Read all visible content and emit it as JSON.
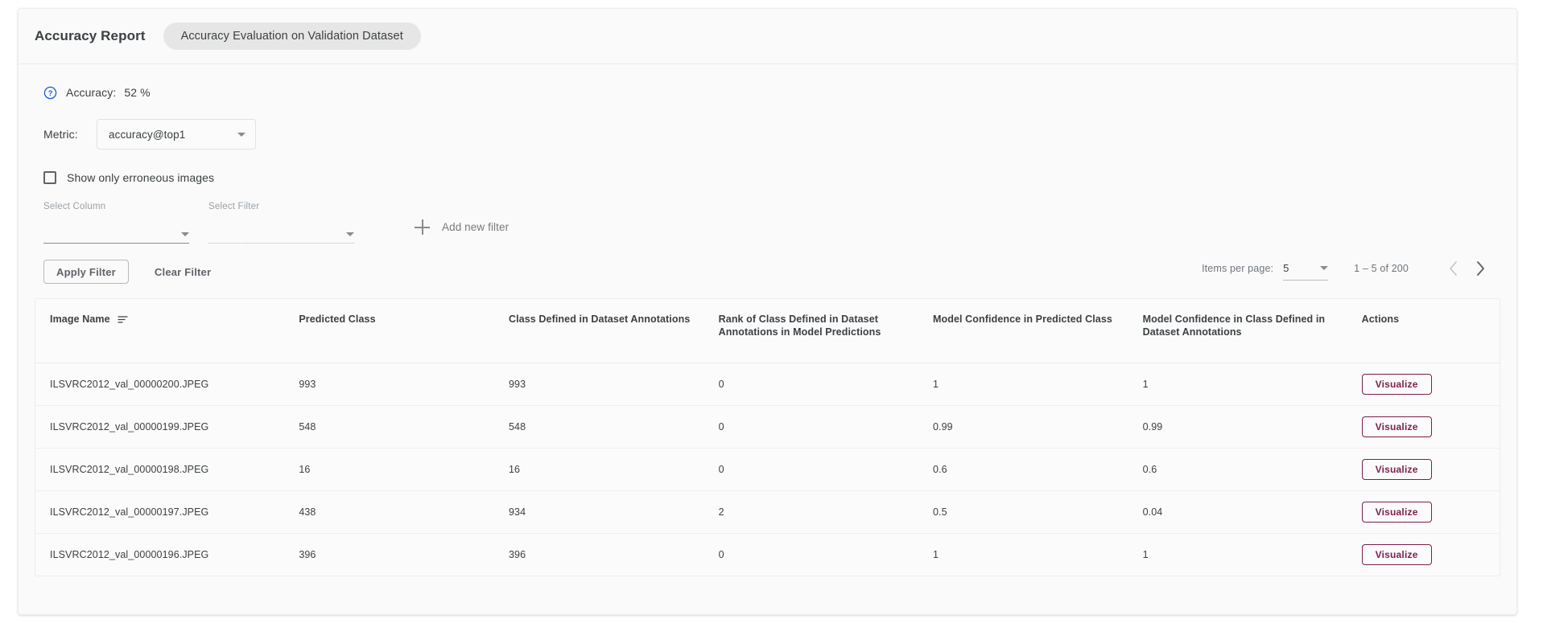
{
  "header": {
    "title": "Accuracy Report",
    "chip": "Accuracy Evaluation on Validation Dataset"
  },
  "summary": {
    "help_icon": "help-circle-icon",
    "accuracy_label": "Accuracy:",
    "accuracy_value": "52 %"
  },
  "metric": {
    "label": "Metric:",
    "selected": "accuracy@top1"
  },
  "erroneous": {
    "label": "Show only erroneous images",
    "checked": false
  },
  "filters": {
    "select_column_label": "Select Column",
    "select_column_value": "",
    "select_filter_label": "Select Filter",
    "select_filter_value": "",
    "add_new_filter": "Add new filter",
    "apply_label": "Apply Filter",
    "clear_label": "Clear Filter"
  },
  "paginator": {
    "items_per_page_label": "Items per page:",
    "items_per_page_value": "5",
    "range_label": "1 – 5 of 200",
    "prev_icon": "chevron-left-icon",
    "next_icon": "chevron-right-icon"
  },
  "table": {
    "columns": [
      "Image Name",
      "Predicted Class",
      "Class Defined in Dataset Annotations",
      "Rank of Class Defined in Dataset Annotations in Model Predictions",
      "Model Confidence in Predicted Class",
      "Model Confidence in Class Defined in Dataset Annotations",
      "Actions"
    ],
    "sort_icon": "sort-icon",
    "action_label": "Visualize",
    "rows": [
      {
        "image_name": "ILSVRC2012_val_00000200.JPEG",
        "predicted_class": "993",
        "dataset_class": "993",
        "rank": "0",
        "conf_predicted": "1",
        "conf_dataset": "1",
        "action": "Visualize"
      },
      {
        "image_name": "ILSVRC2012_val_00000199.JPEG",
        "predicted_class": "548",
        "dataset_class": "548",
        "rank": "0",
        "conf_predicted": "0.99",
        "conf_dataset": "0.99",
        "action": "Visualize"
      },
      {
        "image_name": "ILSVRC2012_val_00000198.JPEG",
        "predicted_class": "16",
        "dataset_class": "16",
        "rank": "0",
        "conf_predicted": "0.6",
        "conf_dataset": "0.6",
        "action": "Visualize"
      },
      {
        "image_name": "ILSVRC2012_val_00000197.JPEG",
        "predicted_class": "438",
        "dataset_class": "934",
        "rank": "2",
        "conf_predicted": "0.5",
        "conf_dataset": "0.04",
        "action": "Visualize"
      },
      {
        "image_name": "ILSVRC2012_val_00000196.JPEG",
        "predicted_class": "396",
        "dataset_class": "396",
        "rank": "0",
        "conf_predicted": "1",
        "conf_dataset": "1",
        "action": "Visualize"
      }
    ]
  },
  "colors": {
    "accent": "#7b1f4b",
    "help_blue": "#1a56db",
    "text": "#3c4043",
    "muted": "#70757a"
  }
}
